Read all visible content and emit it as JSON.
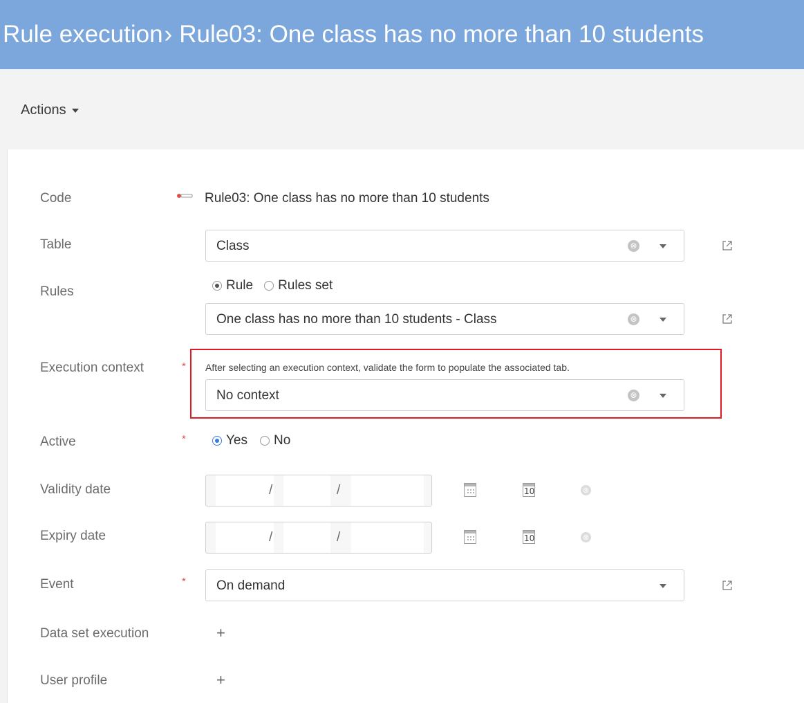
{
  "header": {
    "breadcrumb": "Rule execution",
    "separator": "›",
    "title": "Rule03: One class has no more than 10 students"
  },
  "toolbar": {
    "actions_label": "Actions"
  },
  "form": {
    "code": {
      "label": "Code",
      "value": "Rule03: One class has no more than 10 students"
    },
    "table": {
      "label": "Table",
      "value": "Class"
    },
    "rules": {
      "label": "Rules",
      "options": [
        {
          "label": "Rule",
          "selected": true
        },
        {
          "label": "Rules set",
          "selected": false
        }
      ],
      "value": "One class has no more than 10 students - Class"
    },
    "execution_context": {
      "label": "Execution context",
      "required_mark": "*",
      "hint": "After selecting an execution context, validate the form to populate the associated tab.",
      "value": "No context"
    },
    "active": {
      "label": "Active",
      "required_mark": "*",
      "options": [
        {
          "label": "Yes",
          "selected": true
        },
        {
          "label": "No",
          "selected": false
        }
      ]
    },
    "validity_date": {
      "label": "Validity date",
      "separator": "/",
      "calendar_day": "10"
    },
    "expiry_date": {
      "label": "Expiry date",
      "separator": "/",
      "calendar_day": "10"
    },
    "event": {
      "label": "Event",
      "required_mark": "*",
      "value": "On demand"
    },
    "data_set_execution": {
      "label": "Data set execution",
      "add": "+"
    },
    "user_profile": {
      "label": "User profile",
      "add": "+"
    }
  },
  "icons": {
    "clear": "⊗",
    "external_link": "external-link-icon",
    "calendar": "calendar-icon",
    "today": "calendar-today-icon"
  },
  "colors": {
    "header_bg": "#7ba7dc",
    "highlight": "#e01b24",
    "required": "#d9534f",
    "radio_active": "#3b7ddd"
  }
}
